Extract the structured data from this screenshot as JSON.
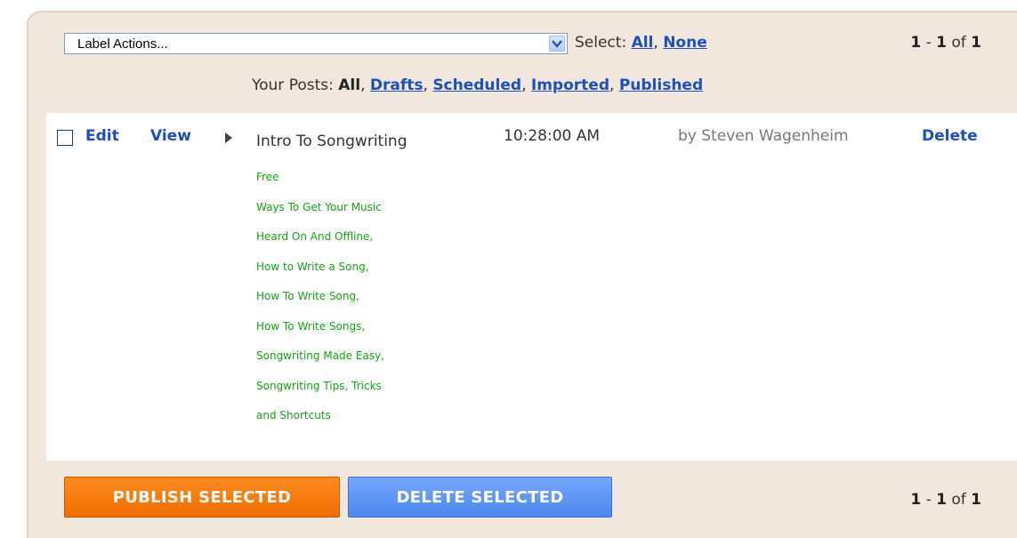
{
  "toolbar": {
    "label_actions": "Label Actions...",
    "select_prefix": "Select:",
    "select_all": "All",
    "select_none": "None"
  },
  "pager": {
    "start": "1",
    "sep": "-",
    "end": "1",
    "of": "of",
    "total": "1"
  },
  "filter": {
    "prefix": "Your Posts:",
    "current": "All",
    "drafts": "Drafts",
    "scheduled": "Scheduled",
    "imported": "Imported",
    "published": "Published"
  },
  "post": {
    "edit": "Edit",
    "view": "View",
    "title": "Intro To Songwriting",
    "labels": "Free\nWays To Get Your Music\nHeard On And Offline,\nHow to Write a Song,\nHow To Write Song,\nHow To Write Songs,\nSongwriting Made Easy,\nSongwriting Tips, Tricks\nand Shortcuts",
    "time": "10:28:00 AM",
    "author": "by Steven Wagenheim",
    "delete": "Delete"
  },
  "actions": {
    "publish": "PUBLISH SELECTED",
    "delete": "DELETE SELECTED"
  },
  "icons": {
    "dropdown": "chevron-down-icon",
    "expand": "triangle-right-icon"
  },
  "colors": {
    "link": "#1d4fbf",
    "labels": "#14a514",
    "publish": "#f67a0c",
    "delete": "#5b95f5",
    "panel": "#f1e7dc"
  }
}
